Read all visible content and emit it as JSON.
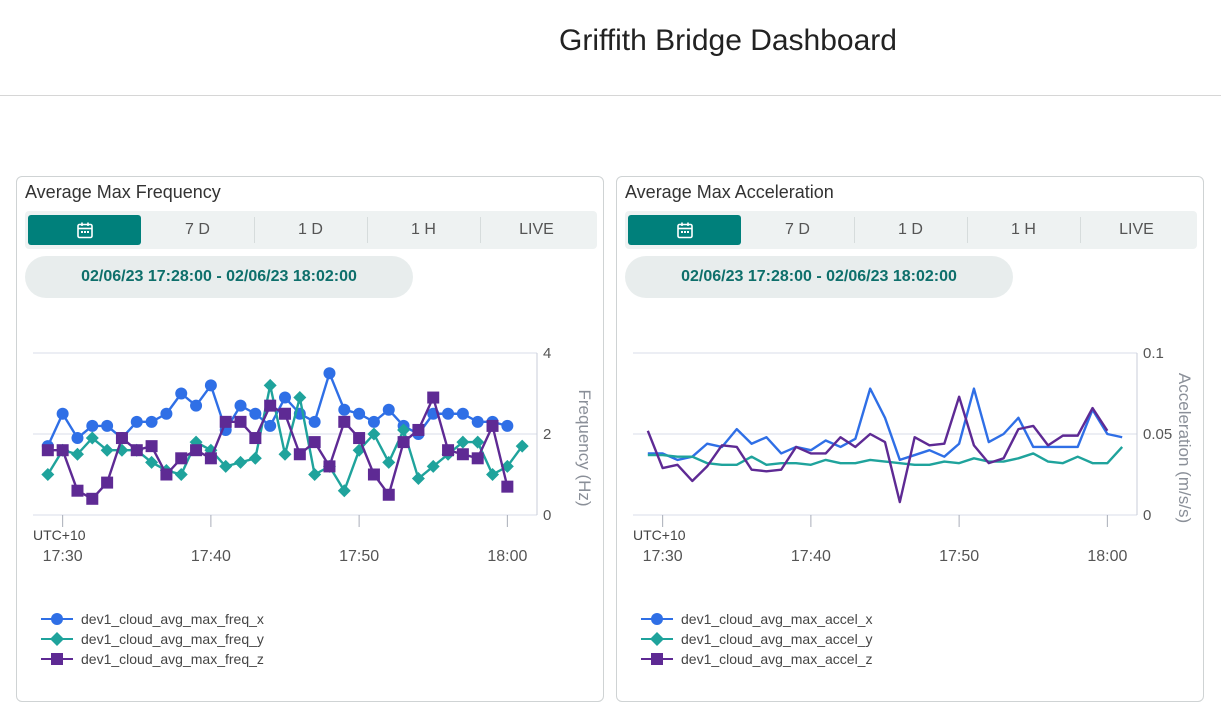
{
  "page_title": "Griffith Bridge Dashboard",
  "range_options": [
    "7 D",
    "1 D",
    "1 H",
    "LIVE"
  ],
  "colors": {
    "x": "#2f6fe6",
    "y": "#1fa39c",
    "z": "#5e2a94",
    "accent": "#00807b"
  },
  "panels": [
    {
      "title": "Average Max Frequency",
      "date_range": "02/06/23 17:28:00 - 02/06/23 18:02:00",
      "legend": [
        "dev1_cloud_avg_max_freq_x",
        "dev1_cloud_avg_max_freq_y",
        "dev1_cloud_avg_max_freq_z"
      ]
    },
    {
      "title": "Average Max Acceleration",
      "date_range": "02/06/23 17:28:00 - 02/06/23 18:02:00",
      "legend": [
        "dev1_cloud_avg_max_accel_x",
        "dev1_cloud_avg_max_accel_y",
        "dev1_cloud_avg_max_accel_z"
      ]
    }
  ],
  "chart_data": [
    {
      "type": "line",
      "timezone_label": "UTC+10",
      "ylabel": "Frequency (Hz)",
      "ylim": [
        0,
        4
      ],
      "yticks": [
        "0",
        "2",
        "4"
      ],
      "xlim": [
        "17:28",
        "18:02"
      ],
      "xticks": [
        "17:30",
        "17:40",
        "17:50",
        "18:00"
      ],
      "markers": true,
      "x": [
        "17:29",
        "17:30",
        "17:31",
        "17:32",
        "17:33",
        "17:34",
        "17:35",
        "17:36",
        "17:37",
        "17:38",
        "17:39",
        "17:40",
        "17:41",
        "17:42",
        "17:43",
        "17:44",
        "17:45",
        "17:46",
        "17:47",
        "17:48",
        "17:49",
        "17:50",
        "17:51",
        "17:52",
        "17:53",
        "17:54",
        "17:55",
        "17:56",
        "17:57",
        "17:58",
        "17:59",
        "18:00",
        "18:01"
      ],
      "series": [
        {
          "name": "dev1_cloud_avg_max_freq_x",
          "values": [
            1.7,
            2.5,
            1.9,
            2.2,
            2.2,
            1.9,
            2.3,
            2.3,
            2.5,
            3.0,
            2.7,
            3.2,
            2.1,
            2.7,
            2.5,
            2.2,
            2.9,
            2.5,
            2.3,
            3.5,
            2.6,
            2.5,
            2.3,
            2.6,
            2.2,
            2.0,
            2.5,
            2.5,
            2.5,
            2.3,
            2.3,
            2.2
          ]
        },
        {
          "name": "dev1_cloud_avg_max_freq_y",
          "values": [
            1.0,
            1.6,
            1.5,
            1.9,
            1.6,
            1.6,
            1.6,
            1.3,
            1.1,
            1.0,
            1.8,
            1.6,
            1.2,
            1.3,
            1.4,
            3.2,
            1.5,
            2.9,
            1.0,
            1.2,
            0.6,
            1.6,
            2.0,
            1.3,
            2.1,
            0.9,
            1.2,
            1.5,
            1.8,
            1.8,
            1.0,
            1.2,
            1.7
          ]
        },
        {
          "name": "dev1_cloud_avg_max_freq_z",
          "values": [
            1.6,
            1.6,
            0.6,
            0.4,
            0.8,
            1.9,
            1.6,
            1.7,
            1.0,
            1.4,
            1.6,
            1.4,
            2.3,
            2.3,
            1.9,
            2.7,
            2.5,
            1.5,
            1.8,
            1.2,
            2.3,
            1.9,
            1.0,
            0.5,
            1.8,
            2.1,
            2.9,
            1.6,
            1.5,
            1.4,
            2.2,
            0.7
          ]
        }
      ]
    },
    {
      "type": "line",
      "timezone_label": "UTC+10",
      "ylabel": "Acceleration (m/s/s)",
      "ylim": [
        0,
        0.1
      ],
      "yticks": [
        "0",
        "0.05",
        "0.1"
      ],
      "xlim": [
        "17:28",
        "18:02"
      ],
      "xticks": [
        "17:30",
        "17:40",
        "17:50",
        "18:00"
      ],
      "markers": false,
      "x": [
        "17:29",
        "17:30",
        "17:31",
        "17:32",
        "17:33",
        "17:34",
        "17:35",
        "17:36",
        "17:37",
        "17:38",
        "17:39",
        "17:40",
        "17:41",
        "17:42",
        "17:43",
        "17:44",
        "17:45",
        "17:46",
        "17:47",
        "17:48",
        "17:49",
        "17:50",
        "17:51",
        "17:52",
        "17:53",
        "17:54",
        "17:55",
        "17:56",
        "17:57",
        "17:58",
        "17:59",
        "18:00",
        "18:01"
      ],
      "series": [
        {
          "name": "dev1_cloud_avg_max_accel_x",
          "values": [
            0.038,
            0.038,
            0.034,
            0.036,
            0.044,
            0.042,
            0.053,
            0.044,
            0.048,
            0.038,
            0.042,
            0.04,
            0.046,
            0.042,
            0.047,
            0.078,
            0.06,
            0.034,
            0.037,
            0.04,
            0.036,
            0.044,
            0.078,
            0.045,
            0.05,
            0.06,
            0.042,
            0.042,
            0.042,
            0.042,
            0.065,
            0.05,
            0.048
          ]
        },
        {
          "name": "dev1_cloud_avg_max_accel_y",
          "values": [
            0.037,
            0.037,
            0.036,
            0.036,
            0.032,
            0.031,
            0.031,
            0.036,
            0.031,
            0.032,
            0.032,
            0.031,
            0.034,
            0.032,
            0.032,
            0.034,
            0.033,
            0.032,
            0.031,
            0.031,
            0.033,
            0.032,
            0.035,
            0.033,
            0.033,
            0.035,
            0.038,
            0.033,
            0.032,
            0.036,
            0.032,
            0.032,
            0.042
          ]
        },
        {
          "name": "dev1_cloud_avg_max_accel_z",
          "values": [
            0.052,
            0.029,
            0.031,
            0.021,
            0.03,
            0.043,
            0.042,
            0.028,
            0.027,
            0.028,
            0.042,
            0.038,
            0.038,
            0.048,
            0.042,
            0.05,
            0.045,
            0.008,
            0.048,
            0.043,
            0.044,
            0.073,
            0.043,
            0.032,
            0.035,
            0.053,
            0.055,
            0.043,
            0.049,
            0.049,
            0.066,
            0.052
          ]
        }
      ]
    }
  ]
}
